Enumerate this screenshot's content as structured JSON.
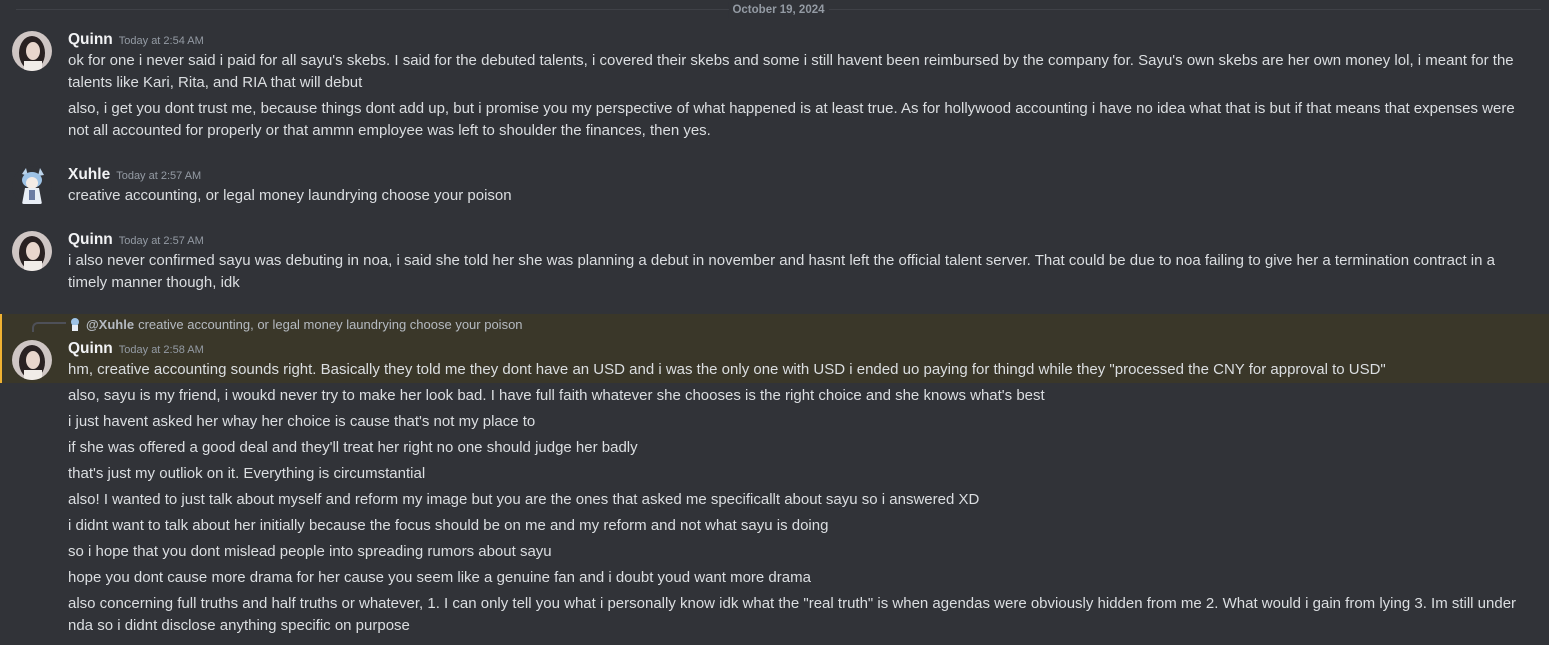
{
  "date_divider": "October 19, 2024",
  "groups": [
    {
      "author": "Quinn",
      "time": "Today at 2:54 AM",
      "avatar": "quinn-avatar",
      "messages": [
        "ok for one i never said i paid for all  sayu's skebs. I said for the debuted talents, i covered their skebs and some i still havent been reimbursed by the company for. Sayu's own skebs are her own money lol, i meant for the talents like Kari, Rita, and RIA that will debut",
        "also, i get you dont trust me, because things dont add up, but i promise you my perspective of what happened is at least true. As for hollywood accounting i have no idea what that is but if that means that expenses were not all accounted for properly or that ammn employee was left to shoulder the finances, then yes."
      ]
    },
    {
      "author": "Xuhle",
      "time": "Today at 2:57 AM",
      "avatar": "xuhle-avatar",
      "messages": [
        "creative accounting, or legal money laundrying choose your poison"
      ]
    },
    {
      "author": "Quinn",
      "time": "Today at 2:57 AM",
      "avatar": "quinn-avatar",
      "messages": [
        "i also never confirmed sayu was debuting in noa, i said she told her she was planning a debut in november and hasnt left the official talent server. That could be due to noa failing to give her a termination contract in a timely manner though, idk"
      ]
    },
    {
      "author": "Quinn",
      "time": "Today at 2:58 AM",
      "avatar": "quinn-avatar",
      "reply": {
        "author": "@Xuhle",
        "text": "creative accounting, or legal money laundrying choose your poison"
      },
      "messages": [
        "hm, creative accounting sounds right. Basically they told me they dont have an USD and i was the only one with USD i ended uo paying for thingd while they \"processed the CNY for approval to USD\"",
        "also, sayu is my friend, i woukd never try to make her look bad. I have full faith whatever she chooses is the right  choice and she knows what's best",
        "i just havent asked her whay her choice is cause that's not my place to",
        "if she was offered a good deal and they'll treat her right no one should judge her badly",
        "that's just my outliok on it. Everything is circumstantial",
        "also! I wanted to just talk about myself and reform my image  but you are the ones that asked me specificallt about sayu so i answered XD",
        "i didnt want to talk about her initially because the focus should be on me and my reform and not what sayu is doing",
        "so i hope that you dont mislead people into spreading rumors about sayu",
        "hope you dont cause more drama for her cause you seem like a genuine fan and i doubt youd want more drama",
        "also concerning full truths and half truths or whatever, 1. I can only tell you what i personally know idk what the \"real truth\" is when agendas were obviously hidden from me 2. What would i gain from lying 3. Im still under nda so i didnt disclose anything specific on purpose"
      ]
    }
  ],
  "colors": {
    "background": "#313338",
    "highlight": "#3a3729",
    "highlight_border": "#f0b232",
    "username": "#f2f3f5",
    "timestamp": "#949ba4",
    "text": "#dbdee1"
  }
}
